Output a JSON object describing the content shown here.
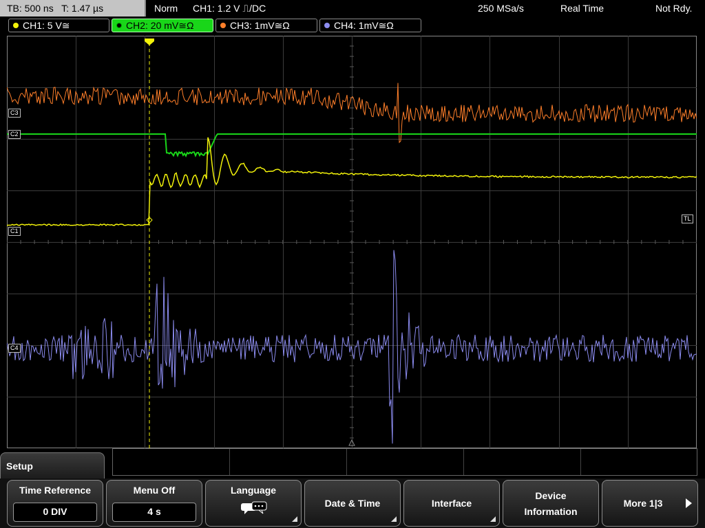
{
  "status_bar": {
    "timebase": "TB: 500 ns",
    "trigger_time": "T: 1.47 µs",
    "mode": "Norm",
    "trigger_info": "CH1: 1.2 V ⎍/DC",
    "sample_rate": "250 MSa/s",
    "acq_mode": "Real Time",
    "status": "Not Rdy."
  },
  "channels": [
    {
      "label": "CH1: 5 V≅",
      "color": "#f2f20a",
      "active": false
    },
    {
      "label": "CH2: 20 mV≅Ω",
      "color": "#19d619",
      "active": true
    },
    {
      "label": "CH3: 1mV≅Ω",
      "color": "#ff7f2a",
      "active": false
    },
    {
      "label": "CH4: 1mV≅Ω",
      "color": "#8c8cf0",
      "active": false
    }
  ],
  "markers": {
    "c1": "C1",
    "c2": "C2",
    "c3": "C3",
    "c4": "C4",
    "trigger_level": "TL"
  },
  "menu": {
    "title": "Setup",
    "softkeys": [
      {
        "title": "Time Reference",
        "value": "0 DIV"
      },
      {
        "title": "Menu Off",
        "value": "4 s"
      },
      {
        "title": "Language",
        "icon": "speech-bubble-icon"
      },
      {
        "title": "Date & Time"
      },
      {
        "title": "Interface"
      },
      {
        "title_line1": "Device",
        "title_line2": "Information"
      },
      {
        "title": "More 1|3"
      }
    ]
  },
  "colors": {
    "ch1": "#f2f20a",
    "ch2": "#19d619",
    "ch3": "#ff7f2a",
    "ch4": "#8c8cf0",
    "grid": "#3c3c3c"
  }
}
